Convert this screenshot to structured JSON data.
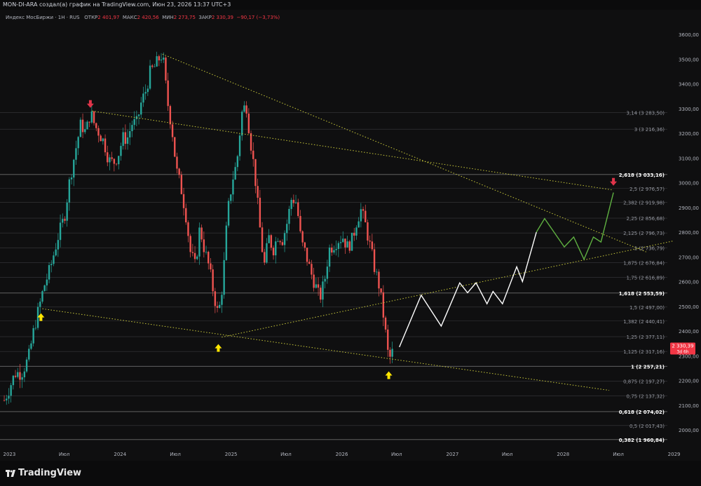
{
  "header": {
    "title": "MON-DI-ARA создал(а) график на TradingView.com, Июн 23, 2026 13:37 UTC+3"
  },
  "legend": {
    "symbol": "Индекс МосБиржи · 1Н · RUS",
    "open_label": "ОТКР",
    "open_value": "2 401,97",
    "high_label": "МАКС",
    "high_value": "2 420,56",
    "low_label": "МИН",
    "low_value": "2 273,75",
    "close_label": "ЗАКР",
    "close_value": "2 330,39",
    "change": "−90,17 (−3,73%)"
  },
  "footer": {
    "brand": "TradingView"
  },
  "colors": {
    "background": "#0f0f10",
    "up": "#26a69a",
    "down": "#ef5350",
    "trendline": "#c8c83a",
    "projection": "#ffffff",
    "projection_alt": "#5fb041",
    "arrow_up": "#ffe600",
    "arrow_down": "#e0344a",
    "price_tag": "#f23645"
  },
  "chart_data": {
    "type": "line",
    "title": "",
    "y_axis_ticks": [
      2000,
      2100,
      2200,
      2300,
      2400,
      2500,
      2600,
      2700,
      2800,
      2900,
      3000,
      3100,
      3200,
      3300,
      3400,
      3500,
      3600
    ],
    "y_tick_labels": [
      "2000,00",
      "2100,00",
      "2200,00",
      "2300,00",
      "2400,00",
      "2500,00",
      "2600,00",
      "2700,00",
      "2800,00",
      "2900,00",
      "3000,00",
      "3100,00",
      "3200,00",
      "3300,00",
      "3400,00",
      "3500,00",
      "3600,00"
    ],
    "ylim": [
      1935,
      3650
    ],
    "x_axis_ticks": [
      "2023",
      "Июл",
      "2024",
      "Июл",
      "2025",
      "Июл",
      "2026",
      "Июл",
      "2027",
      "Июл",
      "2028",
      "Июл",
      "2029"
    ],
    "current_price": {
      "value": 2330.39,
      "label": "2 330,39",
      "sublabel": "3d 6h"
    },
    "fib_levels": [
      {
        "label": "3,14 (3 283,50)",
        "value": 3283.5,
        "bold": false
      },
      {
        "label": "3 (3 216,36)",
        "value": 3216.36,
        "bold": false
      },
      {
        "label": "2,618 (3 033,16)",
        "value": 3033.16,
        "bold": true
      },
      {
        "label": "2,5 (2 976,57)",
        "value": 2976.57,
        "bold": false
      },
      {
        "label": "2,382 (2 919,98)",
        "value": 2919.98,
        "bold": false
      },
      {
        "label": "2,25 (2 856,68)",
        "value": 2856.68,
        "bold": false
      },
      {
        "label": "2,125 (2 796,73)",
        "value": 2796.73,
        "bold": false
      },
      {
        "label": "2 (2 736,79)",
        "value": 2736.79,
        "bold": false
      },
      {
        "label": "1,875 (2 676,84)",
        "value": 2676.84,
        "bold": false
      },
      {
        "label": "1,75 (2 616,89)",
        "value": 2616.89,
        "bold": false
      },
      {
        "label": "1,618 (2 553,59)",
        "value": 2553.59,
        "bold": true
      },
      {
        "label": "1,5 (2 497,00)",
        "value": 2497.0,
        "bold": false
      },
      {
        "label": "1,382 (2 440,41)",
        "value": 2440.41,
        "bold": false
      },
      {
        "label": "1,25 (2 377,11)",
        "value": 2377.11,
        "bold": false
      },
      {
        "label": "1,125 (2 317,16)",
        "value": 2317.16,
        "bold": false
      },
      {
        "label": "1 (2 257,21)",
        "value": 2257.21,
        "bold": true
      },
      {
        "label": "0,875 (2 197,27)",
        "value": 2197.27,
        "bold": false
      },
      {
        "label": "0,75 (2 137,32)",
        "value": 2137.32,
        "bold": false
      },
      {
        "label": "0,618 (2 074,02)",
        "value": 2074.02,
        "bold": true
      },
      {
        "label": "0,5 (2 017,43)",
        "value": 2017.43,
        "bold": false
      },
      {
        "label": "0,382 (1 960,84)",
        "value": 1960.84,
        "bold": true
      }
    ],
    "price_path": [
      [
        "2022-12-15",
        2120
      ],
      [
        "2023-01-01",
        2170
      ],
      [
        "2023-01-20",
        2230
      ],
      [
        "2023-02-10",
        2230
      ],
      [
        "2023-03-05",
        2290
      ],
      [
        "2023-03-25",
        2420
      ],
      [
        "2023-04-10",
        2500
      ],
      [
        "2023-04-25",
        2580
      ],
      [
        "2023-05-15",
        2650
      ],
      [
        "2023-06-10",
        2780
      ],
      [
        "2023-07-01",
        2860
      ],
      [
        "2023-07-20",
        3020
      ],
      [
        "2023-08-10",
        3150
      ],
      [
        "2023-08-25",
        3240
      ],
      [
        "2023-09-10",
        3200
      ],
      [
        "2023-09-25",
        3285
      ],
      [
        "2023-10-10",
        3230
      ],
      [
        "2023-10-25",
        3200
      ],
      [
        "2023-11-10",
        3160
      ],
      [
        "2023-11-25",
        3090
      ],
      [
        "2023-12-10",
        3080
      ],
      [
        "2023-12-25",
        3110
      ],
      [
        "2024-01-10",
        3180
      ],
      [
        "2024-01-25",
        3180
      ],
      [
        "2024-02-10",
        3240
      ],
      [
        "2024-02-25",
        3240
      ],
      [
        "2024-03-10",
        3320
      ],
      [
        "2024-03-25",
        3370
      ],
      [
        "2024-04-10",
        3450
      ],
      [
        "2024-04-25",
        3470
      ],
      [
        "2024-05-10",
        3505
      ],
      [
        "2024-05-20",
        3520
      ],
      [
        "2024-06-05",
        3330
      ],
      [
        "2024-06-20",
        3220
      ],
      [
        "2024-07-05",
        3050
      ],
      [
        "2024-07-20",
        2980
      ],
      [
        "2024-08-05",
        2870
      ],
      [
        "2024-08-20",
        2720
      ],
      [
        "2024-09-05",
        2660
      ],
      [
        "2024-09-20",
        2820
      ],
      [
        "2024-10-05",
        2730
      ],
      [
        "2024-10-20",
        2660
      ],
      [
        "2024-11-05",
        2550
      ],
      [
        "2024-11-20",
        2460
      ],
      [
        "2024-12-05",
        2600
      ],
      [
        "2024-12-20",
        2870
      ],
      [
        "2025-01-05",
        3010
      ],
      [
        "2025-01-20",
        3080
      ],
      [
        "2025-02-05",
        3280
      ],
      [
        "2025-02-20",
        3320
      ],
      [
        "2025-03-05",
        3180
      ],
      [
        "2025-03-20",
        3040
      ],
      [
        "2025-04-05",
        2830
      ],
      [
        "2025-04-20",
        2660
      ],
      [
        "2025-05-05",
        2780
      ],
      [
        "2025-05-20",
        2730
      ],
      [
        "2025-06-05",
        2790
      ],
      [
        "2025-06-20",
        2770
      ],
      [
        "2025-07-05",
        2840
      ],
      [
        "2025-07-20",
        2940
      ],
      [
        "2025-08-05",
        2920
      ],
      [
        "2025-08-20",
        2760
      ],
      [
        "2025-09-05",
        2710
      ],
      [
        "2025-09-20",
        2640
      ],
      [
        "2025-10-05",
        2590
      ],
      [
        "2025-10-20",
        2530
      ],
      [
        "2025-11-05",
        2600
      ],
      [
        "2025-11-20",
        2730
      ],
      [
        "2025-12-05",
        2750
      ],
      [
        "2025-12-20",
        2770
      ],
      [
        "2026-01-05",
        2780
      ],
      [
        "2026-01-20",
        2740
      ],
      [
        "2026-02-05",
        2770
      ],
      [
        "2026-02-20",
        2850
      ],
      [
        "2026-03-05",
        2890
      ],
      [
        "2026-03-20",
        2830
      ],
      [
        "2026-04-05",
        2740
      ],
      [
        "2026-04-20",
        2650
      ],
      [
        "2026-05-05",
        2580
      ],
      [
        "2026-05-20",
        2450
      ],
      [
        "2026-06-05",
        2280
      ],
      [
        "2026-06-23",
        2330
      ]
    ],
    "projection_path": [
      [
        "2026-07-10",
        2335
      ],
      [
        "2026-09-20",
        2545
      ],
      [
        "2026-11-25",
        2420
      ],
      [
        "2027-01-25",
        2595
      ],
      [
        "2027-02-20",
        2555
      ],
      [
        "2027-03-20",
        2595
      ],
      [
        "2027-04-25",
        2510
      ],
      [
        "2027-05-15",
        2560
      ],
      [
        "2027-06-15",
        2510
      ],
      [
        "2027-08-01",
        2660
      ],
      [
        "2027-08-20",
        2600
      ],
      [
        "2027-10-05",
        2800
      ]
    ],
    "projection_alt_path": [
      [
        "2027-10-05",
        2800
      ],
      [
        "2027-11-01",
        2855
      ],
      [
        "2028-01-05",
        2740
      ],
      [
        "2028-02-05",
        2780
      ],
      [
        "2028-03-10",
        2690
      ],
      [
        "2028-04-10",
        2780
      ],
      [
        "2028-05-05",
        2760
      ],
      [
        "2028-06-15",
        2960
      ]
    ],
    "trendlines": [
      [
        [
          "2023-10-01",
          3290
        ],
        [
          "2028-06-15",
          2970
        ]
      ],
      [
        [
          "2024-05-20",
          3520
        ],
        [
          "2028-10-01",
          2720
        ]
      ],
      [
        [
          "2023-04-20",
          2490
        ],
        [
          "2028-06-01",
          2160
        ]
      ],
      [
        [
          "2024-12-01",
          2375
        ],
        [
          "2029-01-01",
          2765
        ]
      ]
    ],
    "markers": [
      {
        "kind": "down",
        "date": "2023-09-25",
        "value": 3320
      },
      {
        "kind": "up",
        "date": "2023-04-15",
        "value": 2455
      },
      {
        "kind": "up",
        "date": "2024-11-20",
        "value": 2330
      },
      {
        "kind": "up",
        "date": "2026-06-05",
        "value": 2220
      },
      {
        "kind": "down",
        "date": "2028-06-15",
        "value": 3005
      }
    ]
  }
}
